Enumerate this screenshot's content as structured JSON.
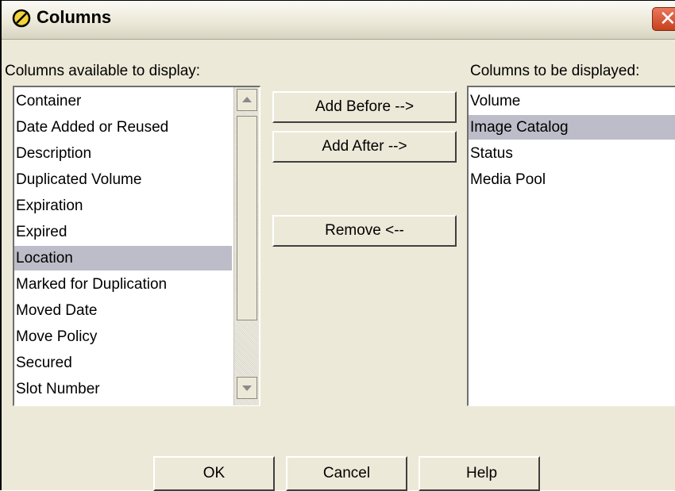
{
  "window": {
    "title": "Columns",
    "title_icon": "circle-slash-icon",
    "close_icon": "close-icon"
  },
  "available": {
    "label": "Columns available to display:",
    "items": [
      "Container",
      "Date Added or Reused",
      "Description",
      "Duplicated Volume",
      "Expiration",
      "Expired",
      "Location",
      "Marked for Duplication",
      "Moved Date",
      "Move Policy",
      "Secured",
      "Slot Number"
    ],
    "selected_index": 6
  },
  "displayed": {
    "label": "Columns to be displayed:",
    "items": [
      "Volume",
      "Image Catalog",
      "Status",
      "Media Pool"
    ],
    "selected_index": 1
  },
  "buttons": {
    "add_before": "Add Before -->",
    "add_after": "Add After -->",
    "remove": "Remove <--"
  },
  "footer": {
    "ok": "OK",
    "cancel": "Cancel",
    "help": "Help"
  },
  "colors": {
    "selection": "#bdbdc9",
    "dialog_bg": "#ece9d8",
    "close_button": "#d9532e"
  }
}
